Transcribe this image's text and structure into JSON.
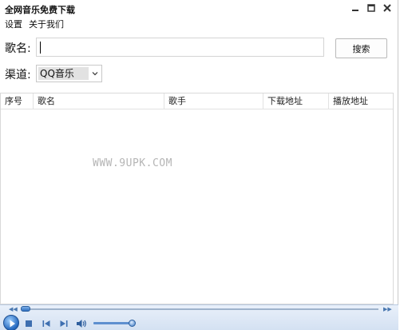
{
  "window": {
    "title": "全网音乐免费下载"
  },
  "menu": {
    "settings": "设置",
    "about": "关于我们"
  },
  "form": {
    "song_label": "歌名:",
    "song_value": "",
    "search_button": "搜索",
    "channel_label": "渠道:",
    "channel_selected": "QQ音乐"
  },
  "table": {
    "columns": [
      "序号",
      "歌名",
      "歌手",
      "下载地址",
      "播放地址"
    ],
    "rows": []
  },
  "watermark": "WWW.9UPK.COM",
  "player": {
    "seek_left_glyph": "◀◀",
    "seek_right_glyph": "▶▶",
    "seek_progress": 0.0,
    "volume_level": 0.85
  },
  "colors": {
    "player_accent": "#2467bd",
    "player_bg": "#dfe8f5"
  }
}
